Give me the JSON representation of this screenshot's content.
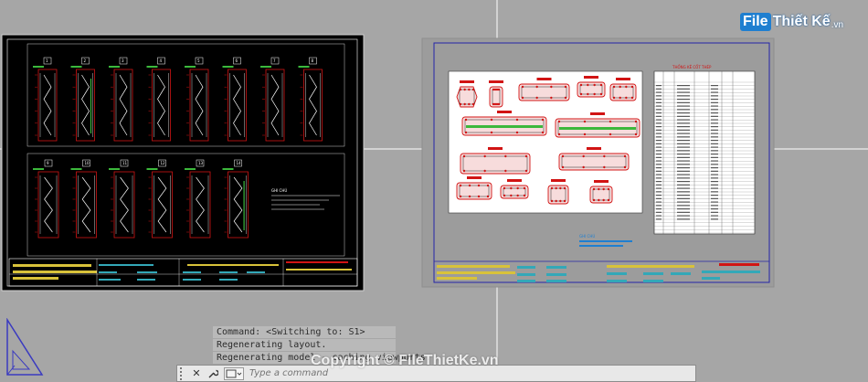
{
  "command_history": [
    "Command:  <Switching to: S1>",
    "Regenerating layout.",
    "Regenerating model - caching viewports."
  ],
  "command_bar": {
    "placeholder": "Type a command",
    "close_glyph": "✕",
    "tool_glyph": "🔧"
  },
  "logo": {
    "badge": "File",
    "rest": "Thiết Kế",
    "domain": ".vn"
  },
  "watermark": "Copyright © FileThietKe.vn",
  "sheet_left": {
    "row1_labels": [
      "1",
      "2",
      "3",
      "4",
      "5",
      "6",
      "7",
      "8"
    ],
    "row2_labels": [
      "9",
      "10",
      "11",
      "12",
      "13",
      "14"
    ],
    "note_title": "GHI CHÚ"
  },
  "sheet_right": {
    "table_title": "THỐNG KÊ CỐT THÉP",
    "note_title": "GHI CHÚ"
  },
  "colors": {
    "background": "#a6a6a6",
    "sheet_black": "#000000",
    "detail_red": "#d11414",
    "frame_blue": "#2424a8",
    "crosshair": "#ffffff"
  }
}
